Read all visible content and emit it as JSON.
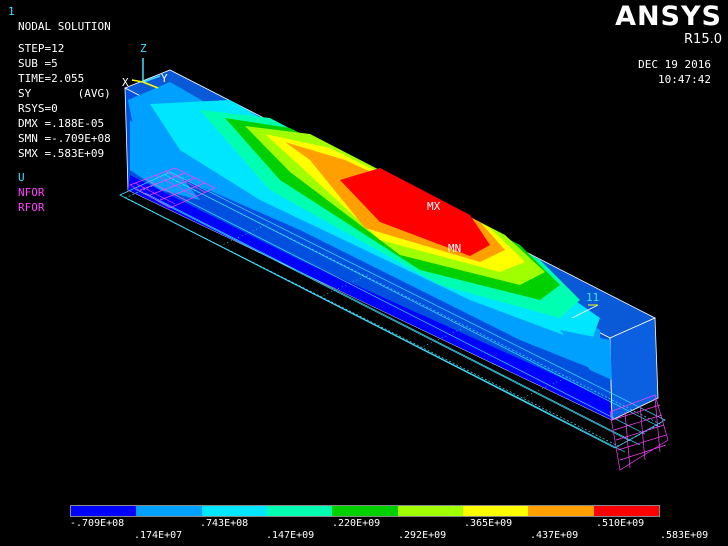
{
  "window_number": "1",
  "header": {
    "title": "NODAL SOLUTION",
    "lines": [
      "STEP=12",
      "SUB =5",
      "TIME=2.055",
      "SY       (AVG)",
      "RSYS=0",
      "DMX =.188E-05",
      "SMN =-.709E+08",
      "SMX =.583E+09"
    ]
  },
  "legend_items": [
    {
      "label": "U",
      "color": "#40e0ff"
    },
    {
      "label": "NFOR",
      "color": "#ff40ff"
    },
    {
      "label": "RFOR",
      "color": "#ff40ff"
    }
  ],
  "brand": {
    "name": "ANSYS",
    "version": "R15.0"
  },
  "datetime": {
    "date": "DEC 19 2016",
    "time": "10:47:42"
  },
  "axes": {
    "z": "Z",
    "x": "X",
    "y": "Y"
  },
  "markers": {
    "max": "MX",
    "min": "MN",
    "node": "11"
  },
  "colorbar": {
    "colors": [
      "#0000ff",
      "#00a0ff",
      "#00e6ff",
      "#00ffb0",
      "#00d000",
      "#a0ff00",
      "#ffff00",
      "#ffa000",
      "#ff0000"
    ],
    "tick_labels_top": [
      "-.709E+08",
      ".743E+08",
      ".220E+09",
      ".365E+09",
      ".510E+09"
    ],
    "tick_labels_bottom": [
      ".174E+07",
      ".147E+09",
      ".292E+09",
      ".437E+09",
      ".583E+09"
    ]
  }
}
